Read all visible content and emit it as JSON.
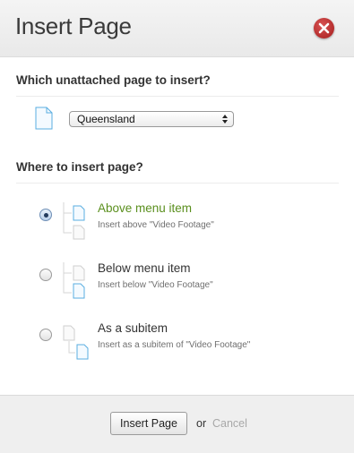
{
  "dialog": {
    "title": "Insert Page",
    "close_icon": "close-icon",
    "accent_close": "#c0392b"
  },
  "page_select": {
    "heading": "Which unattached page to insert?",
    "icon": "page-icon",
    "selected_value": "Queensland"
  },
  "position": {
    "heading": "Where to insert page?",
    "options": [
      {
        "title": "Above menu item",
        "description": "Insert above \"Video Footage\"",
        "checked": true,
        "icon": "tree-above-icon"
      },
      {
        "title": "Below menu item",
        "description": "Insert below \"Video Footage\"",
        "checked": false,
        "icon": "tree-below-icon"
      },
      {
        "title": "As a subitem",
        "description": "Insert as a subitem of \"Video Footage\"",
        "checked": false,
        "icon": "tree-subitem-icon"
      }
    ]
  },
  "footer": {
    "insert_label": "Insert Page",
    "or_label": "or",
    "cancel_label": "Cancel"
  },
  "colors": {
    "selected_option": "#5a8f1d",
    "page_icon_active": "#5aaee0"
  }
}
